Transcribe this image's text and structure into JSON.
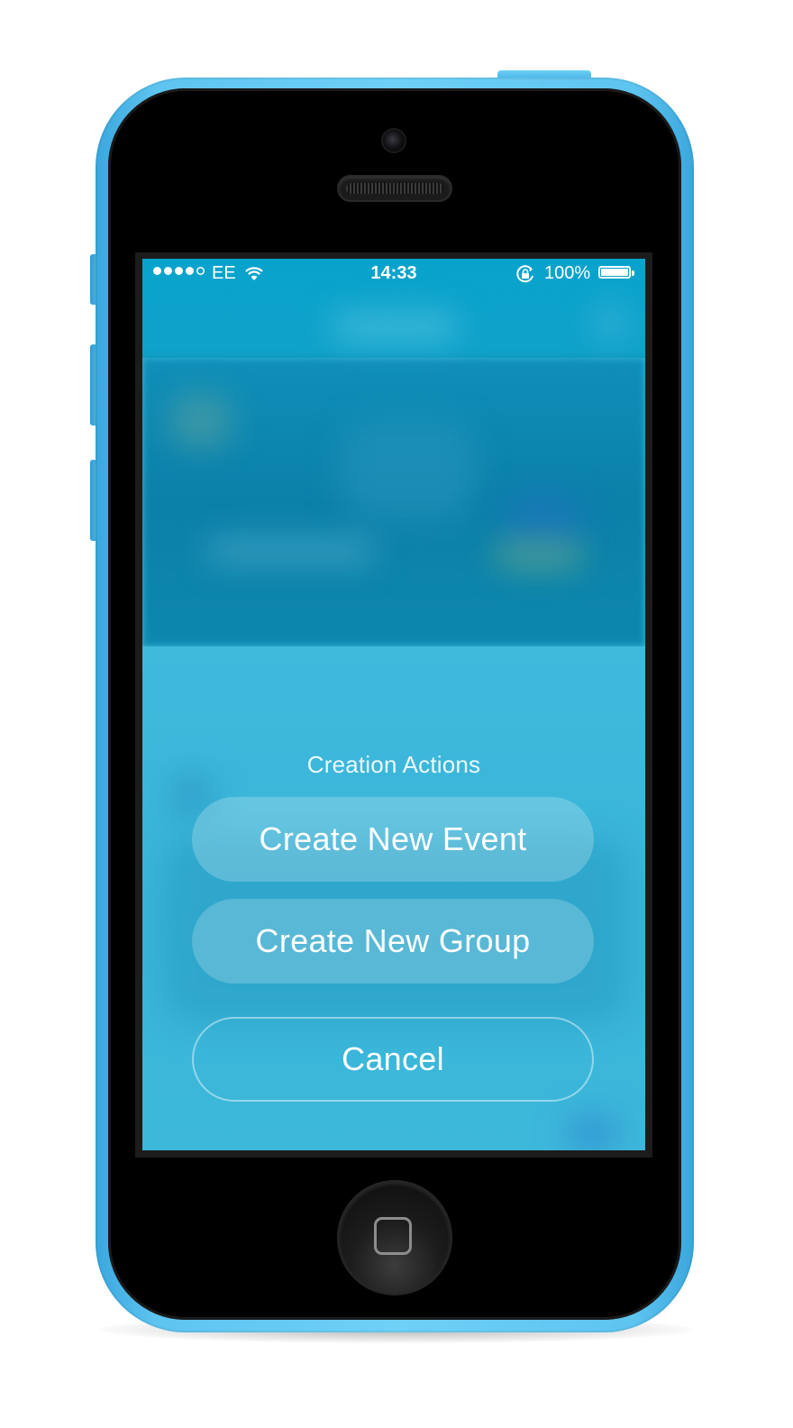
{
  "status_bar": {
    "signal_strength": 4,
    "signal_max": 5,
    "carrier": "EE",
    "time": "14:33",
    "battery_percent": "100%",
    "battery_level": 1.0,
    "icons": [
      "wifi-icon",
      "rotation-lock-icon",
      "battery-icon"
    ]
  },
  "action_sheet": {
    "title": "Creation Actions",
    "buttons": [
      {
        "label": "Create New Event"
      },
      {
        "label": "Create New Group"
      },
      {
        "label": "Cancel"
      }
    ]
  },
  "colors": {
    "device_shell": "#5ec4f0",
    "screen_top": "#08a3cd",
    "screen_overlay": "#3cb8da",
    "text": "#ffffff"
  }
}
